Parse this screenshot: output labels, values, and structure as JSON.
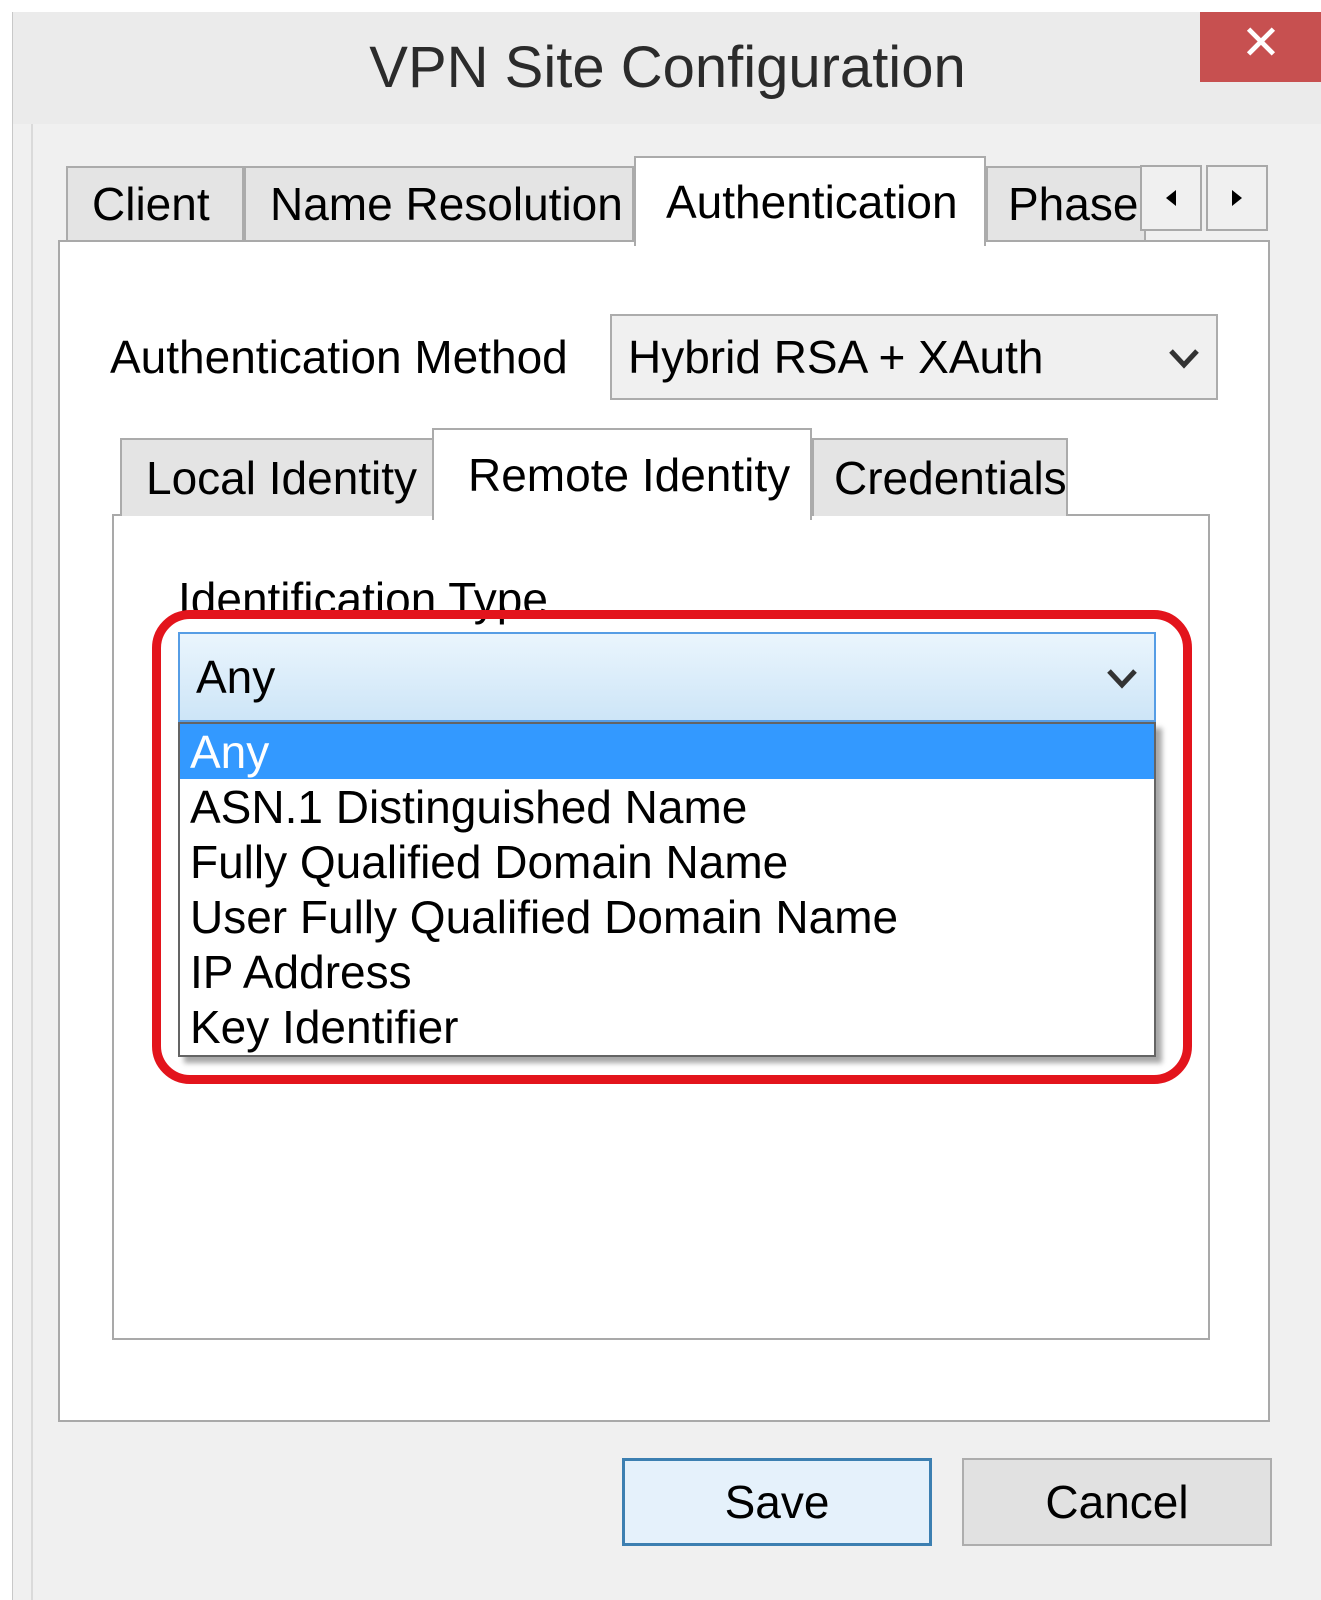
{
  "window": {
    "title": "VPN Site Configuration",
    "close_glyph": "✕"
  },
  "tabs": [
    {
      "label": "Client",
      "active": false
    },
    {
      "label": "Name Resolution",
      "active": false
    },
    {
      "label": "Authentication",
      "active": true
    },
    {
      "label": "Phase",
      "active": false
    }
  ],
  "tab_scroll": {
    "left_icon": "arrow-left-icon",
    "right_icon": "arrow-right-icon"
  },
  "auth": {
    "method_label": "Authentication Method",
    "method_value": "Hybrid RSA + XAuth"
  },
  "subtabs": [
    {
      "label": "Local Identity",
      "active": false
    },
    {
      "label": "Remote Identity",
      "active": true
    },
    {
      "label": "Credentials",
      "active": false
    }
  ],
  "remote_identity": {
    "id_type_label": "Identification Type",
    "id_type_value": "Any",
    "options": [
      "Any",
      "ASN.1 Distinguished Name",
      "Fully Qualified Domain Name",
      "User Fully Qualified Domain Name",
      "IP Address",
      "Key Identifier"
    ],
    "selected_index": 0
  },
  "buttons": {
    "save": "Save",
    "cancel": "Cancel"
  },
  "colors": {
    "highlight_ring": "#e3141c",
    "selection": "#3399ff",
    "close_button": "#c75050"
  }
}
